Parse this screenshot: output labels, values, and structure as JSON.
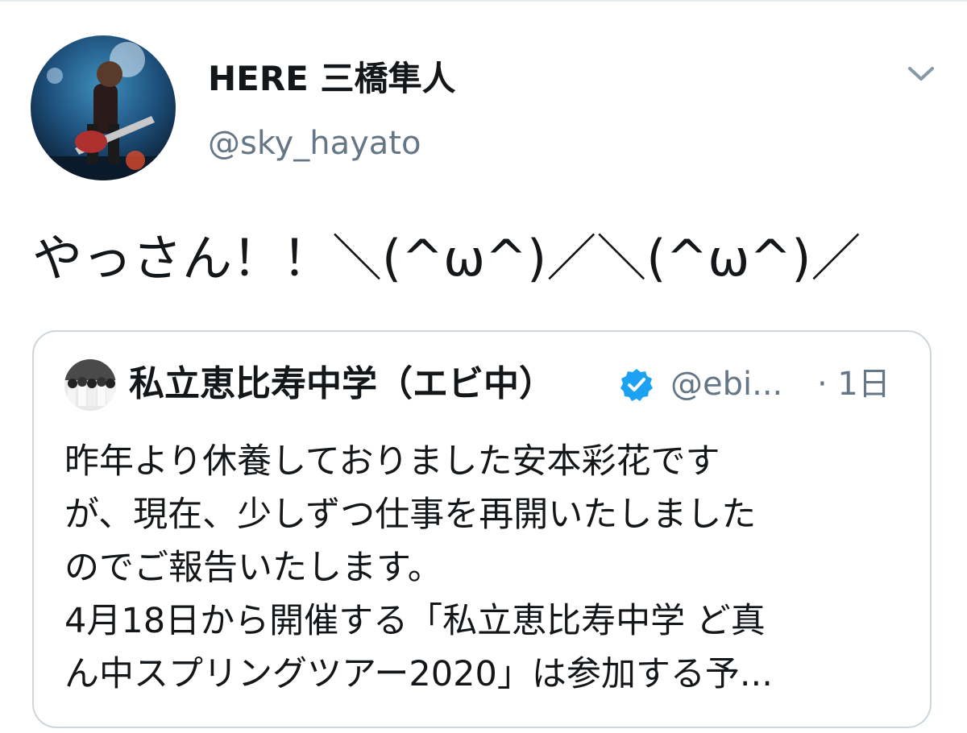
{
  "author": {
    "name": "HERE 三橋隼人",
    "handle": "@sky_hayato"
  },
  "tweet": {
    "text": "やっさん！！＼(^ω^)／＼(^ω^)／"
  },
  "quoted_tweet": {
    "author_name": "私立恵比寿中学（エビ中）",
    "handle": "@ebi...",
    "time": "· 1日",
    "body_lines": [
      "昨年より休養しておりました安本彩花です",
      "が、現在、少しずつ仕事を再開いたしました",
      "のでご報告いたします。",
      "4月18日から開催する「私立恵比寿中学 ど真",
      "ん中スプリングツアー2020」は参加する予..."
    ]
  },
  "icons": {
    "menu": "chevron-down-icon",
    "verified": "verified-badge-icon"
  },
  "colors": {
    "text": "#14171a",
    "secondary": "#657786",
    "border": "#ccd6dd",
    "verified": "#1da1f2"
  }
}
